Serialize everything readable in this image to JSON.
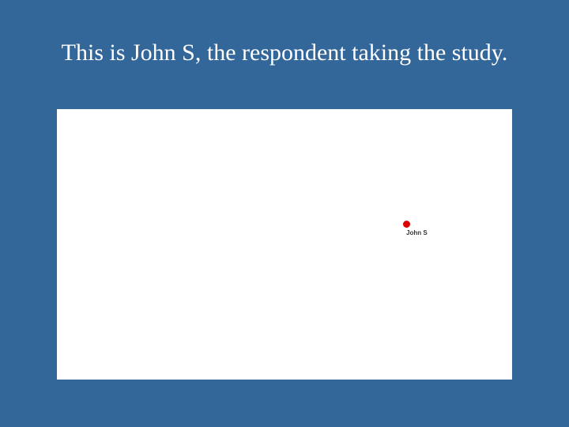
{
  "slide": {
    "title": "This is John S, the respondent taking the study."
  },
  "network": {
    "nodes": [
      {
        "label": "John S",
        "color": "#dd0000"
      }
    ]
  },
  "colors": {
    "background": "#336699",
    "canvas": "#ffffff",
    "node": "#dd0000"
  }
}
